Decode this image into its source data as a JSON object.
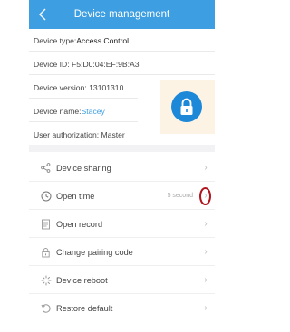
{
  "header": {
    "title": "Device management",
    "back_icon": "chevron-left-icon"
  },
  "info": {
    "device_type_label": "Device type: ",
    "device_type_value": "Access Control",
    "device_id": "Device ID: F5:D0:04:EF:9B:A3",
    "device_version": "Device version: 13101310",
    "device_name_label": "Device name: ",
    "device_name_value": "Stacey",
    "user_authorization": "User authorization: Master",
    "lock_icon": "lock-icon"
  },
  "menu": {
    "items": [
      {
        "label": "Device sharing",
        "icon": "share-icon",
        "value": ""
      },
      {
        "label": "Open time",
        "icon": "clock-icon",
        "value": "5 second"
      },
      {
        "label": "Open record",
        "icon": "record-icon",
        "value": ""
      },
      {
        "label": "Change pairing code",
        "icon": "lock-code-icon",
        "value": ""
      },
      {
        "label": "Device reboot",
        "icon": "reboot-icon",
        "value": ""
      },
      {
        "label": "Restore default",
        "icon": "restore-icon",
        "value": ""
      }
    ]
  },
  "colors": {
    "header": "#3d9fe1",
    "lock_circle": "#1e88d8",
    "highlight": "#b0151e"
  }
}
